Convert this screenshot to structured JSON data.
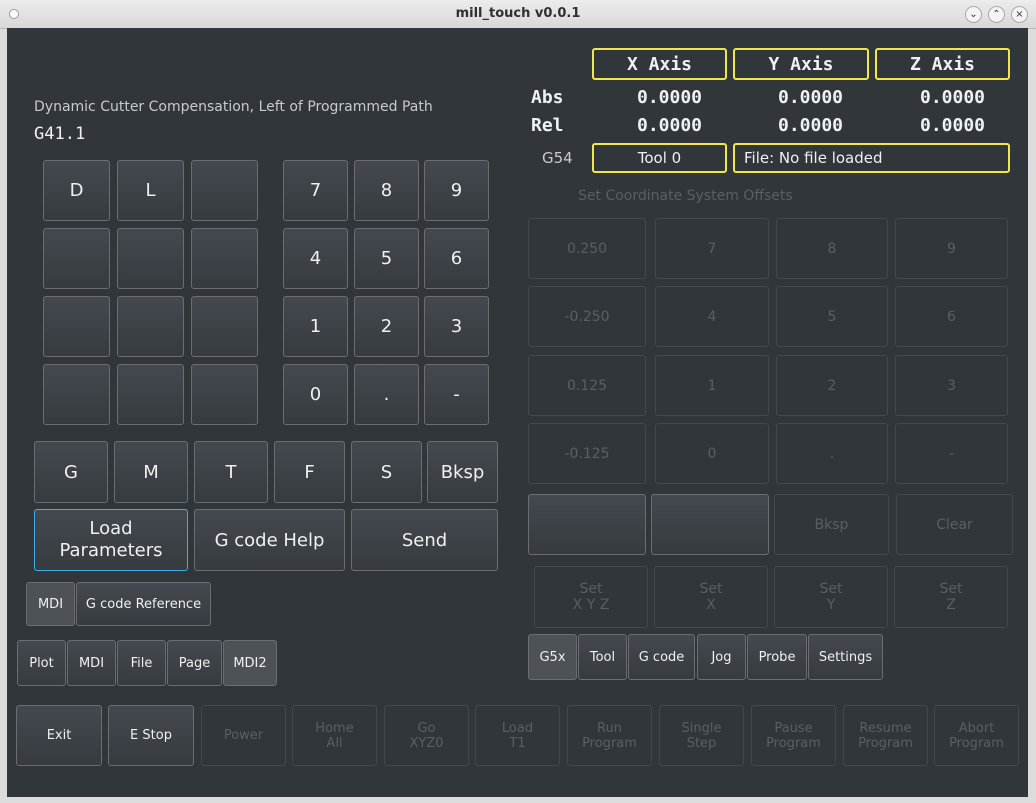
{
  "window": {
    "title": "mill_touch v0.0.1",
    "wm_buttons": [
      "⌄",
      "⌃",
      "×"
    ]
  },
  "mdi": {
    "description": "Dynamic Cutter Compensation, Left of Programmed Path",
    "command": "G41.1",
    "param_keys": [
      "D",
      "L",
      "",
      "",
      "",
      "",
      "",
      "",
      "",
      "",
      "",
      ""
    ],
    "num_keys": [
      "7",
      "8",
      "9",
      "4",
      "5",
      "6",
      "1",
      "2",
      "3",
      "0",
      ".",
      "-"
    ],
    "letter_keys": [
      "G",
      "M",
      "T",
      "F",
      "S",
      "Bksp"
    ],
    "load_parameters": "Load Parameters",
    "gcode_help": "G code Help",
    "send": "Send",
    "sub_tabs": [
      "MDI",
      "G code Reference"
    ]
  },
  "page_tabs": [
    "Plot",
    "MDI",
    "File",
    "Page",
    "MDI2"
  ],
  "dro": {
    "axes": [
      "X Axis",
      "Y Axis",
      "Z Axis"
    ],
    "rows": [
      {
        "label": "Abs",
        "values": [
          "0.0000",
          "0.0000",
          "0.0000"
        ]
      },
      {
        "label": "Rel",
        "values": [
          "0.0000",
          "0.0000",
          "0.0000"
        ]
      }
    ],
    "coord_system": "G54",
    "tool": "Tool 0",
    "file": "File: No file loaded"
  },
  "offsets": {
    "title": "Set Coordinate System Offsets",
    "jog_values": [
      "0.250",
      "-0.250",
      "0.125",
      "-0.125"
    ],
    "keys": [
      "7",
      "8",
      "9",
      "4",
      "5",
      "6",
      "1",
      "2",
      "3",
      "0",
      ".",
      "-"
    ],
    "row5": [
      "",
      "",
      "Bksp",
      "Clear"
    ],
    "set_buttons": [
      "Set\nX Y Z",
      "Set\nX",
      "Set\nY",
      "Set\nZ"
    ]
  },
  "right_tabs": [
    "G5x",
    "Tool",
    "G code",
    "Jog",
    "Probe",
    "Settings"
  ],
  "bottom_bar": [
    "Exit",
    "E Stop",
    "Power",
    "Home\nAll",
    "Go\nXYZ0",
    "Load\nT1",
    "Run\nProgram",
    "Single\nStep",
    "Pause\nProgram",
    "Resume\nProgram",
    "Abort\nProgram"
  ]
}
